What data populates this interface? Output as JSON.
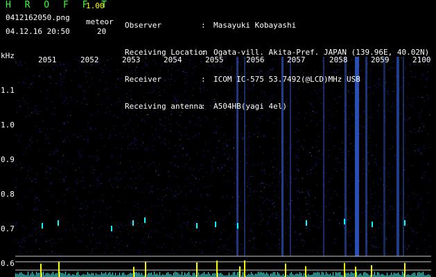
{
  "header": {
    "title": "H R O F F T",
    "version": "1.00",
    "filename": "0412162050.png",
    "meteor_label": "meteor",
    "datetime": "04.12.16 20:50",
    "meteor_count": "20"
  },
  "info": [
    {
      "key": "Observer",
      "sep": ":",
      "value": "Masayuki Kobayashi"
    },
    {
      "key": "Receiving Location",
      "sep": ":",
      "value": "Ogata-vill. Akita-Pref. JAPAN (139.96E, 40.02N)"
    },
    {
      "key": "Receiver",
      "sep": ":",
      "value": "ICOM IC-575 53.7492(@LCD)MHz USB"
    },
    {
      "key": "Receiving antenna",
      "sep": ":",
      "value": "A504HB(yagi 4el)"
    }
  ],
  "time_axis": [
    "2051",
    "2052",
    "2053",
    "2054",
    "2055",
    "2056",
    "2057",
    "2058",
    "2059",
    "2100"
  ],
  "freq_axis": {
    "unit": "kHz",
    "ticks": [
      "1.1",
      "1.0",
      "0.9",
      "0.8",
      "0.7",
      "0.6"
    ]
  },
  "colors": {
    "background": "#000000",
    "noise": "#1a2ad8",
    "strong": "#00ffff",
    "meteor": "#ffff00",
    "grid": "#c8c8c8"
  }
}
